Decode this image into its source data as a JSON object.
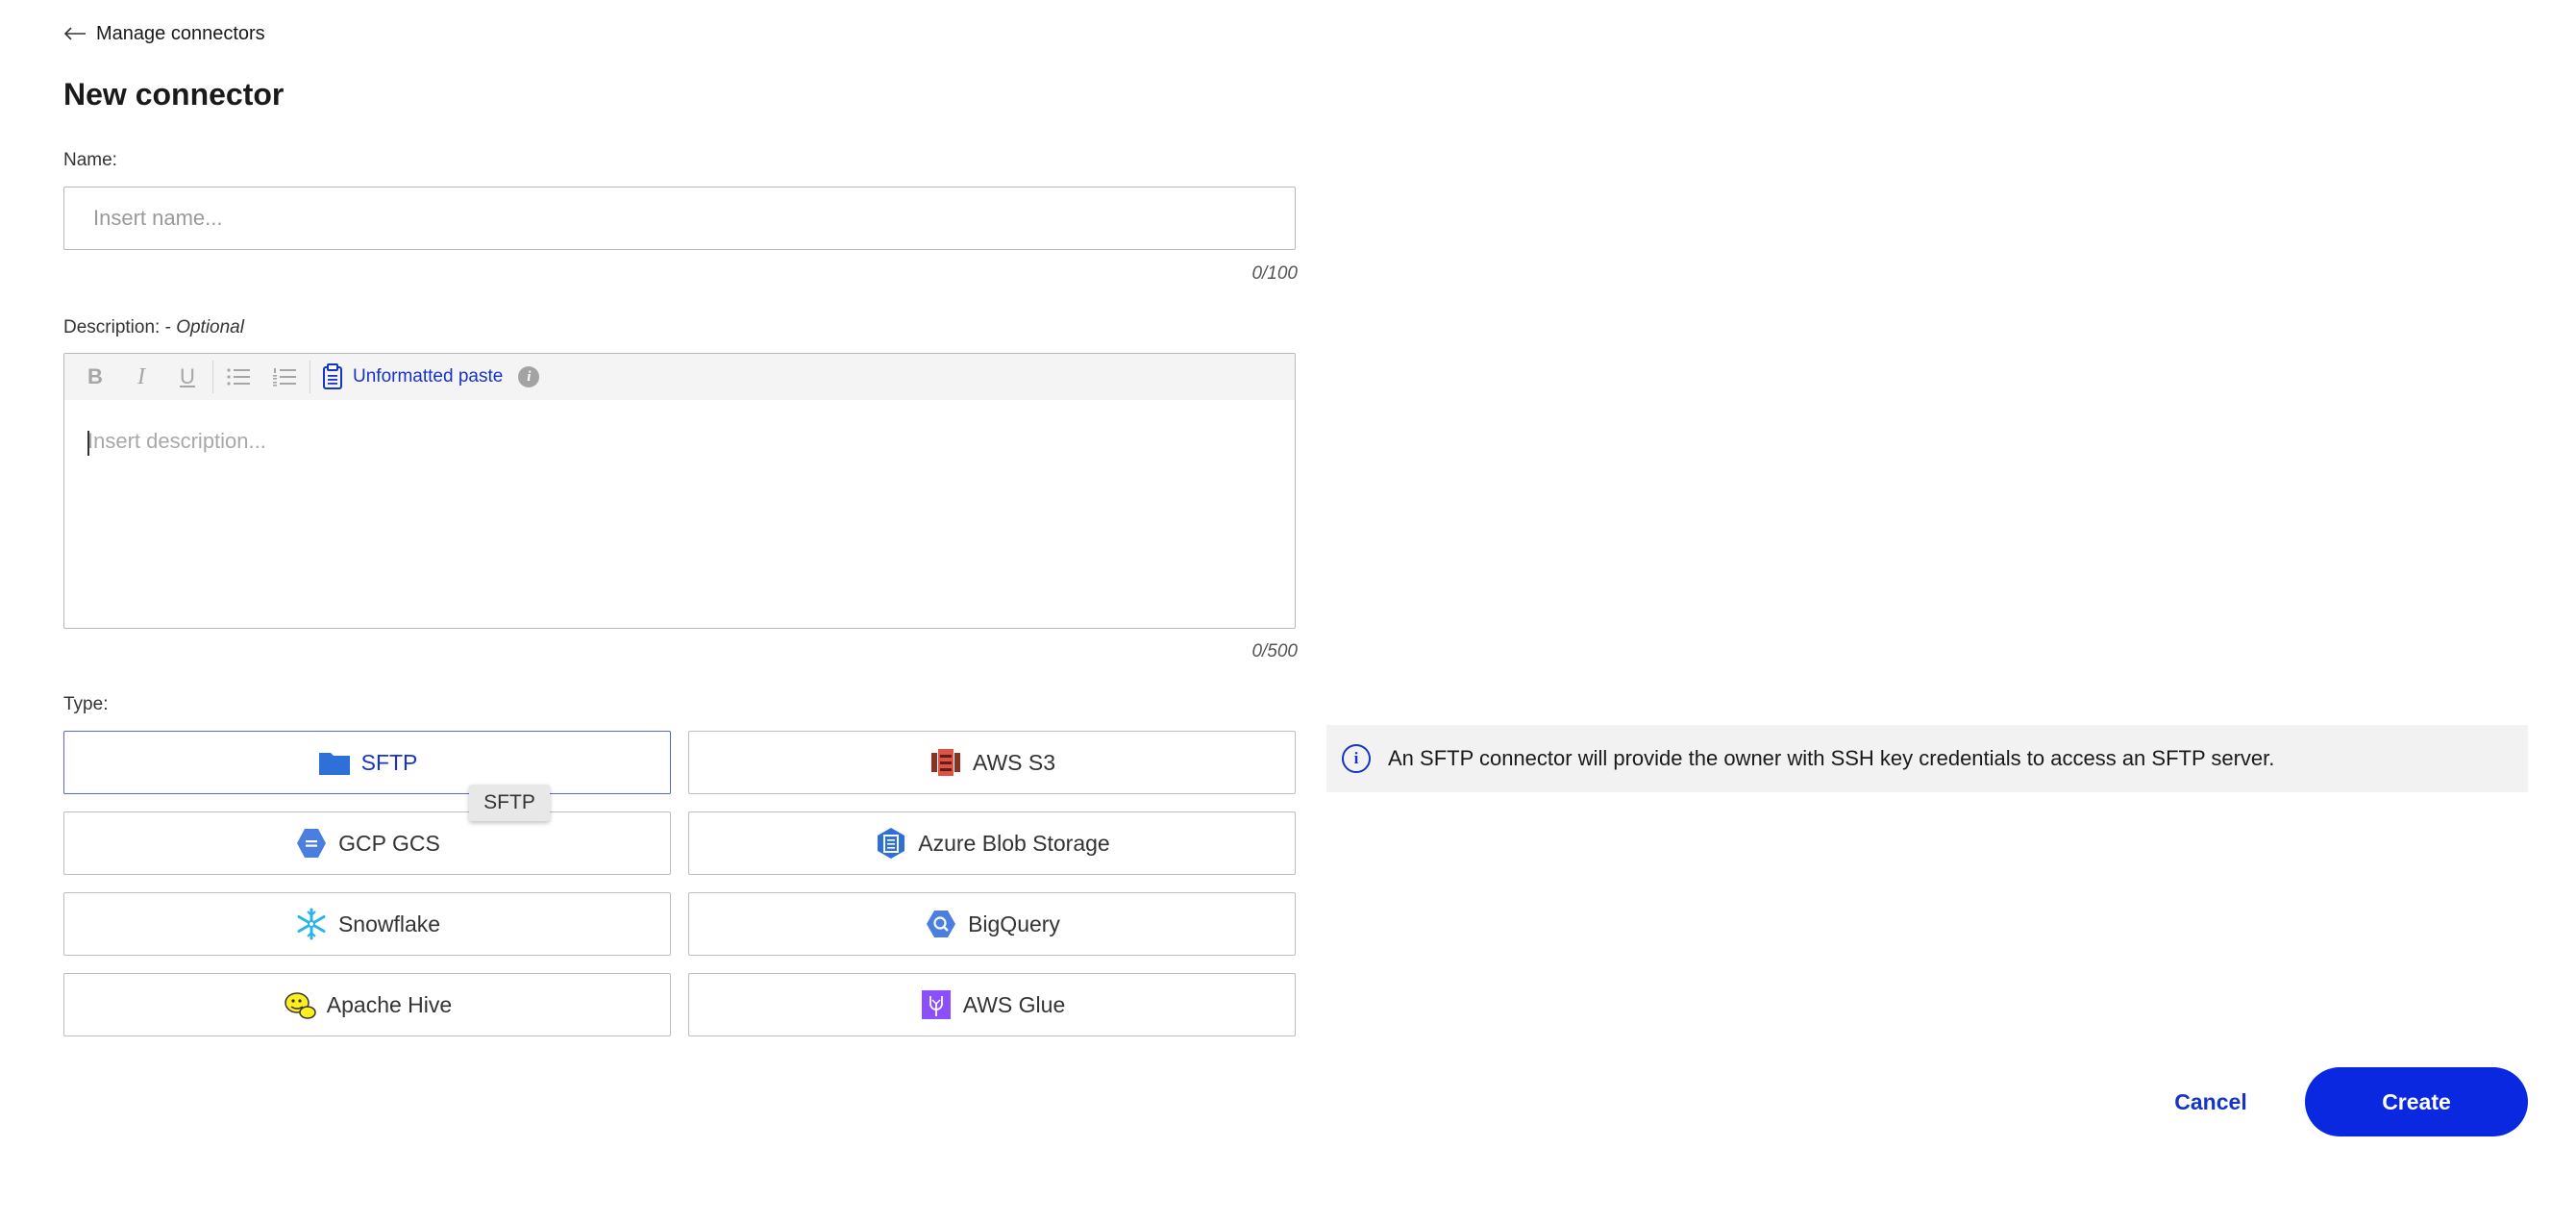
{
  "nav": {
    "back_label": "Manage connectors"
  },
  "page": {
    "title": "New connector"
  },
  "name_field": {
    "label": "Name:",
    "placeholder": "Insert name...",
    "value": "",
    "counter": "0/100"
  },
  "description_field": {
    "label": "Description: - ",
    "optional": "Optional",
    "placeholder": "Insert description...",
    "counter": "0/500",
    "toolbar": {
      "bold": "B",
      "italic": "I",
      "underline": "U",
      "paste_label": "Unformatted paste",
      "info_glyph": "i"
    }
  },
  "type_field": {
    "label": "Type:",
    "options": [
      {
        "label": "SFTP",
        "icon": "folder-icon",
        "selected": true
      },
      {
        "label": "AWS S3",
        "icon": "aws-s3-icon",
        "selected": false
      },
      {
        "label": "GCP GCS",
        "icon": "gcp-gcs-icon",
        "selected": false
      },
      {
        "label": "Azure Blob Storage",
        "icon": "azure-blob-icon",
        "selected": false
      },
      {
        "label": "Snowflake",
        "icon": "snowflake-icon",
        "selected": false
      },
      {
        "label": "BigQuery",
        "icon": "bigquery-icon",
        "selected": false
      },
      {
        "label": "Apache Hive",
        "icon": "hive-icon",
        "selected": false
      },
      {
        "label": "AWS Glue",
        "icon": "aws-glue-icon",
        "selected": false
      }
    ],
    "tooltip": "SFTP"
  },
  "info_banner": {
    "glyph": "i",
    "text": "An SFTP connector will provide the owner with SSH key credentials to access an SFTP server."
  },
  "actions": {
    "cancel_label": "Cancel",
    "create_label": "Create"
  },
  "colors": {
    "accent": "#0a28e0",
    "link": "#1634c9",
    "selected_border": "#5a66e0"
  }
}
